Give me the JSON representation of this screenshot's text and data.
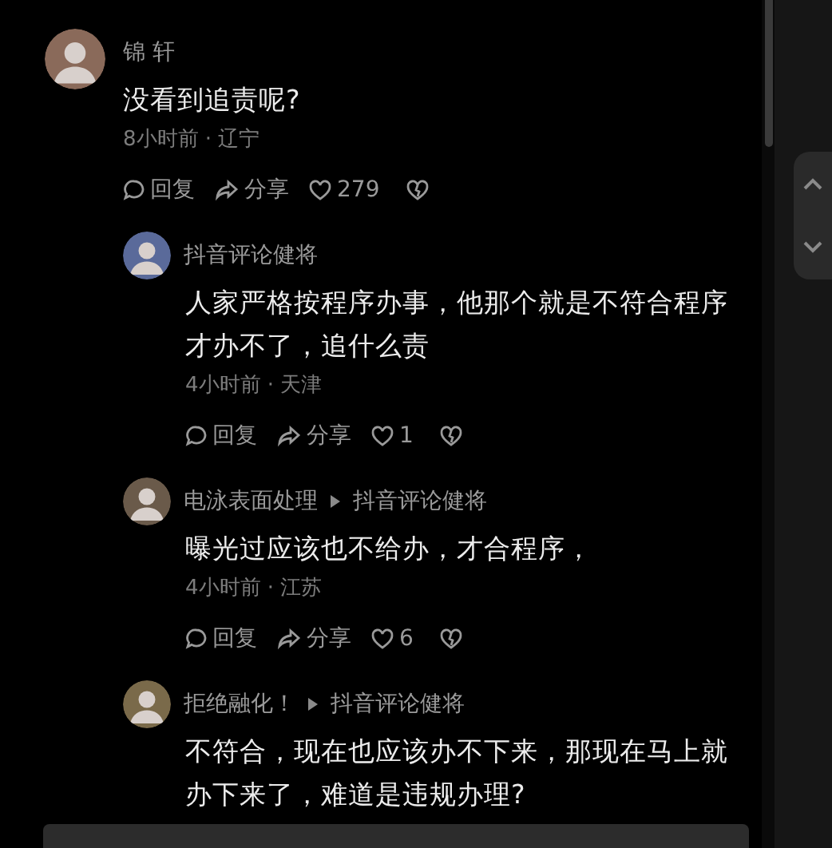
{
  "comment": {
    "author": "锦 轩",
    "text": "没看到追责呢?",
    "meta": "8小时前 · 辽宁",
    "actions": {
      "reply": "回复",
      "share": "分享",
      "likes": "279"
    }
  },
  "replies": [
    {
      "author": "抖音评论健将",
      "text": "人家严格按程序办事，他那个就是不符合程序才办不了，追什么责",
      "meta": "4小时前 · 天津",
      "actions": {
        "reply": "回复",
        "share": "分享",
        "likes": "1"
      }
    },
    {
      "author": "电泳表面处理",
      "reply_to": "抖音评论健将",
      "text": "曝光过应该也不给办，才合程序，",
      "meta": "4小时前 · 江苏",
      "actions": {
        "reply": "回复",
        "share": "分享",
        "likes": "6"
      }
    },
    {
      "author": "拒绝融化！",
      "reply_to": "抖音评论健将",
      "text": "不符合，现在也应该办不下来，那现在马上就办下来了，难道是违规办理?"
    }
  ]
}
